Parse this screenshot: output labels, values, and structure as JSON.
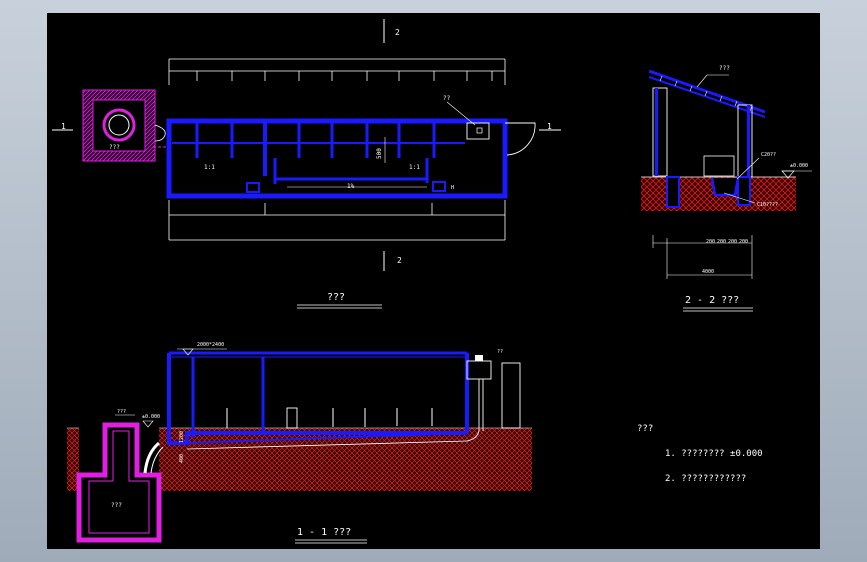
{
  "drawing": {
    "plan_title": "???",
    "section_11_title": "1 - 1 ???",
    "section_22_title": "2 - 2 ???",
    "section_mark_1": "1",
    "section_mark_2": "2",
    "plan_labels": {
      "chamber": "???",
      "tag_top_right": "??",
      "basin_left": "1:1",
      "basin_right": "1:1",
      "dim_vertical": "500",
      "slope_note": "1%",
      "marker_right": "H"
    },
    "section11_labels": {
      "level_top": "2000*2400",
      "chamber": "???",
      "elev": "±0.000",
      "dim_left": "1200",
      "dim_small": "400",
      "tag_right": "??"
    },
    "section22_labels": {
      "roof": "???",
      "elev": "±0.000",
      "note_a": "C20??",
      "note_b": "C10????",
      "dims_top": [
        "200",
        "200",
        "200",
        "200"
      ],
      "dim_total": "4000"
    },
    "notes": {
      "heading": "???",
      "line1": "1. ???????? ±0.000",
      "line2": "2. ????????????"
    }
  },
  "colors": {
    "background": "#000000",
    "wall": "#1a1aff",
    "line": "#ffffff",
    "soil": "#cc1f1f",
    "chamber": "#e020e0"
  }
}
